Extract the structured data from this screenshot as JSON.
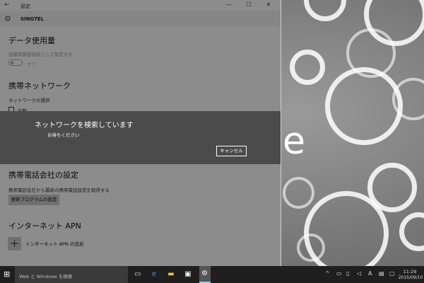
{
  "window": {
    "title": "設定",
    "back": "←",
    "minimize": "—",
    "maximize": "☐",
    "close": "✕"
  },
  "header": {
    "icon": "gear-icon",
    "network_name": "SINGTEL"
  },
  "sections": {
    "data_usage": {
      "heading": "データ使用量",
      "description": "従量制課金接続として設定する",
      "toggle_label": "オフ",
      "toggle_on": false
    },
    "cellular": {
      "heading": "携帯ネットワーク",
      "select_label": "ネットワークの選択",
      "auto_label": "自動"
    },
    "carrier": {
      "heading": "携帯電話会社の設定",
      "description": "携帯電話会社から最新の携帯電話設定を取得する",
      "update_button": "更新プログラムの設定"
    },
    "apn": {
      "heading": "インターネット APN",
      "add_icon": "+",
      "add_label": "インターネット APN の追加"
    }
  },
  "dialog": {
    "title": "ネットワークを検索しています",
    "subtitle": "お待ちください",
    "cancel": "キャンセル"
  },
  "wallpaper": {
    "letter": "e"
  },
  "taskbar": {
    "start_icon": "⊞",
    "search_placeholder": "Web と Windows を検索",
    "taskview_icon": "▭",
    "edge_icon": "e",
    "explorer_icon": "▬",
    "store_icon": "▣",
    "settings_icon": "⚙",
    "tray": {
      "up": "^",
      "network": "▭",
      "battery": "▯",
      "volume": "◁",
      "ime": "A",
      "keyboard": "▤",
      "action": "▢"
    },
    "time": "11:29",
    "date": "2015/09/10"
  }
}
